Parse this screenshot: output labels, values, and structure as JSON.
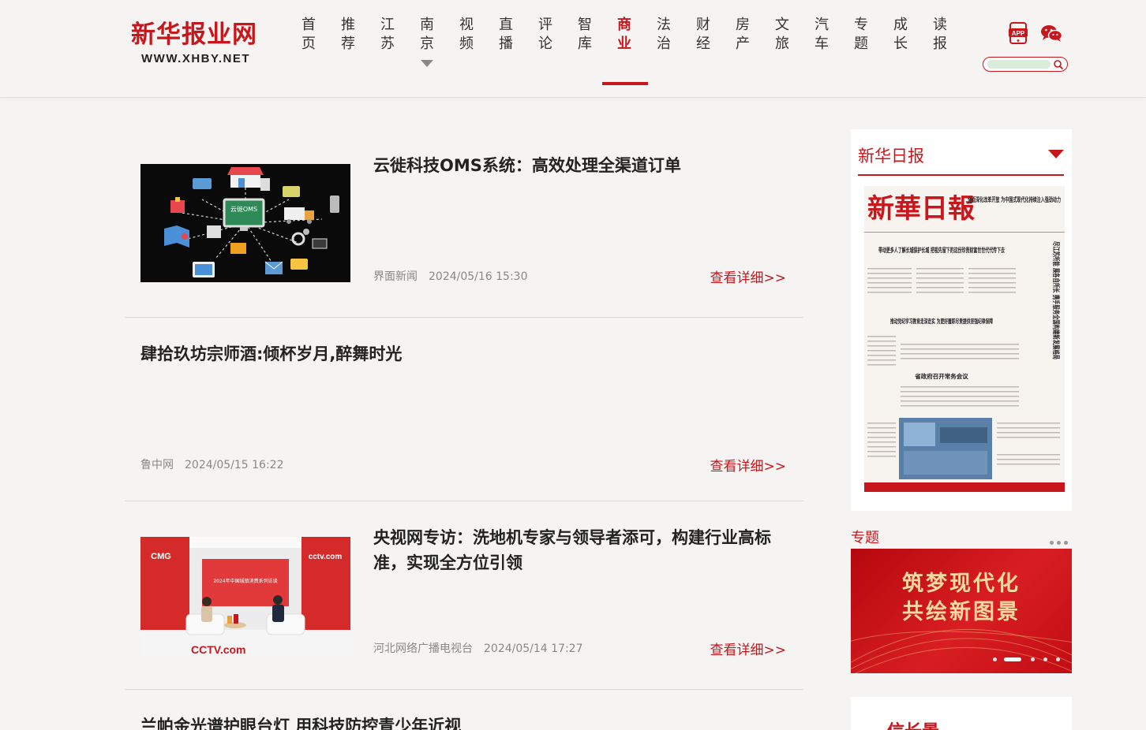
{
  "header": {
    "logo_cn": "新华报业网",
    "logo_en": "WWW.XHBY.NET",
    "nav": [
      {
        "label": "首页"
      },
      {
        "label": "推荐"
      },
      {
        "label": "江苏"
      },
      {
        "label": "南京"
      },
      {
        "label": "视频"
      },
      {
        "label": "直播"
      },
      {
        "label": "评论"
      },
      {
        "label": "智库"
      },
      {
        "label": "商业"
      },
      {
        "label": "法治"
      },
      {
        "label": "财经"
      },
      {
        "label": "房产"
      },
      {
        "label": "文旅"
      },
      {
        "label": "汽车"
      },
      {
        "label": "专题"
      },
      {
        "label": "成长"
      },
      {
        "label": "读报"
      }
    ],
    "active_nav": "商业",
    "app_icon_label": "APP",
    "search": {
      "placeholder": ""
    }
  },
  "articles": [
    {
      "title": "云徙科技OMS系统：高效处理全渠道订单",
      "source": "界面新闻",
      "date": "2024/05/16 15:30",
      "more": "查看详细>>",
      "thumb_caption": "云徙OMS"
    },
    {
      "title": "肆拾玖坊宗师酒:倾杯岁月,醉舞时光",
      "source": "鲁中网",
      "date": "2024/05/15 16:22",
      "more": "查看详细>>"
    },
    {
      "title": "央视网专访：洗地机专家与领导者添可，构建行业高标准，实现全方位引领",
      "source": "河北网络广播电视台",
      "date": "2024/05/14 17:27",
      "more": "查看详细>>",
      "thumb_texts": {
        "left_logo": "CMG",
        "right_logo": "cctv.com",
        "bottom_logo": "CCTV.com",
        "backdrop_caption": "2024年中国城镇消费系列访谈"
      }
    },
    {
      "title": "兰帕金光谱护眼台灯 用科技防控青少年近视"
    }
  ],
  "sidebar": {
    "paper_title": "新华日报",
    "paper_image": {
      "masthead": "新華日報",
      "headline_1": "全面深化改革开放 为中国式现代化持续注入强劲动力",
      "headline_2": "带动更多人了解长城保护长城 把祖先留下的这份珍贵财富世世代代传下去",
      "headline_3": "推动党纪学习教育走深走实 为更好履职尽责提供坚强纪律保障",
      "headline_4": "省政府召开常务会议",
      "side_headline": "尽江苏所能 展各自所长 携手服务全国构建新发展格局"
    },
    "topic_label": "专题",
    "banner_line1": "筑梦现代化",
    "banner_line2": "共绘新图景",
    "bottom_card_text": "信长景"
  },
  "colors": {
    "brand_red": "#c8161d",
    "page_bg": "#f5f4f2",
    "meta_gray": "#888888"
  }
}
